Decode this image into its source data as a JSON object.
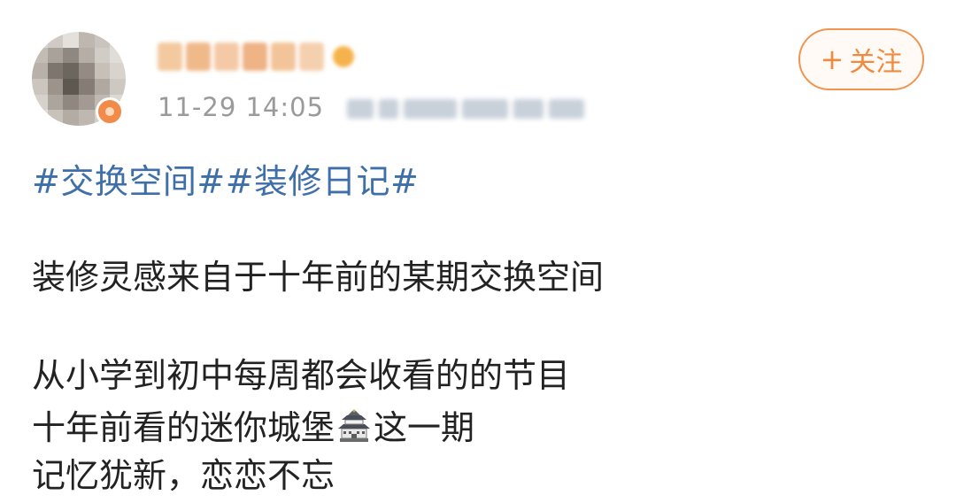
{
  "post": {
    "time": "11-29 14:05",
    "follow_button": {
      "plus": "+",
      "label": "关注"
    },
    "hashtags": [
      "#交换空间#",
      "#装修日记#"
    ],
    "lines": {
      "line1": "装修灵感来自于十年前的某期交换空间",
      "line2": "从小学到初中每周都会收看的的节目",
      "line3_before": "十年前看的迷你城堡",
      "line3_emoji": "castle-emoji",
      "line3_after": "这一期",
      "line4": "记忆犹新，恋恋不忘"
    }
  },
  "colors": {
    "hashtag": "#3e6fa8",
    "follow_accent": "#f08a3e",
    "meta_text": "#9a9a9a",
    "body_text": "#222222"
  }
}
